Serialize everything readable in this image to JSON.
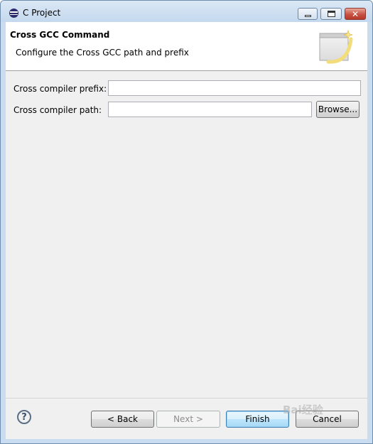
{
  "window": {
    "title": "C Project",
    "icon": "eclipse-icon",
    "controls": {
      "minimize": "minimize-icon",
      "maximize": "maximize-icon",
      "close": "close-icon"
    }
  },
  "header": {
    "title": "Cross GCC Command",
    "description": "Configure the Cross GCC path and prefix",
    "banner_icon": "wizard-banner-icon"
  },
  "form": {
    "prefix_label": "Cross compiler prefix:",
    "prefix_value": "",
    "path_label": "Cross compiler path:",
    "path_value": "",
    "browse_label": "Browse..."
  },
  "footer": {
    "help_icon": "help-icon",
    "help_glyph": "?",
    "back_label": "< Back",
    "next_label": "Next >",
    "finish_label": "Finish",
    "cancel_label": "Cancel"
  },
  "watermark": "Bai经验",
  "colors": {
    "titlebar": "#c9dcf0",
    "panel": "#f0f0f0",
    "default_button_border": "#3c7fb1",
    "close_button": "#c75243"
  }
}
